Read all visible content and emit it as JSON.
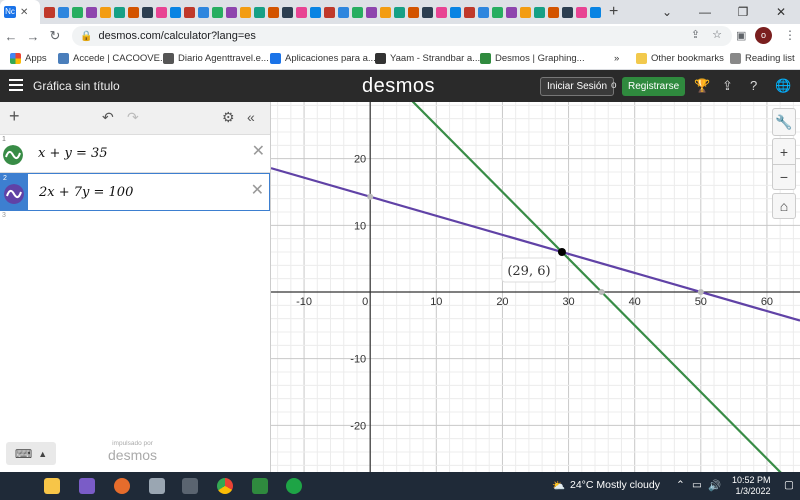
{
  "browser": {
    "active_tab_label": "Nc",
    "url": "desmos.com/calculator?lang=es",
    "bookmarks": [
      {
        "label": "Apps",
        "color": "#ea4335"
      },
      {
        "label": "Accede | CACOOVE...",
        "color": "#4a7ebb"
      },
      {
        "label": "Diario Agenttravel.e...",
        "color": "#555555"
      },
      {
        "label": "Aplicaciones para a...",
        "color": "#1a73e8"
      },
      {
        "label": "Yaam - Strandbar a...",
        "color": "#333333"
      },
      {
        "label": "Desmos | Graphing...",
        "color": "#2f8a3e"
      }
    ],
    "bookmarks_more": "»",
    "other_bookmarks": "Other bookmarks",
    "reading_list": "Reading list",
    "profile_initial": "o"
  },
  "app": {
    "graph_title": "Gráfica sin título",
    "logo": "desmos",
    "login_label": "Iniciar Sesión",
    "or_label": "o",
    "signup_label": "Registrarse"
  },
  "expressions": [
    {
      "index": "1",
      "latex": "x + y = 35",
      "color": "#388c46"
    },
    {
      "index": "2",
      "latex": "2x + 7y = 100",
      "color": "#6042a6"
    },
    {
      "index": "3",
      "latex": ""
    }
  ],
  "powered_by": {
    "small": "impulsado por",
    "brand": "desmos"
  },
  "chart_data": {
    "type": "line",
    "x_range": [
      -15,
      65
    ],
    "y_range": [
      -27,
      28.5
    ],
    "x_ticks": [
      -10,
      0,
      10,
      20,
      30,
      40,
      50,
      60
    ],
    "y_ticks": [
      -20,
      -10,
      10,
      20
    ],
    "grid": true,
    "series": [
      {
        "equation": "x + y = 35",
        "color": "#388c46",
        "intercepts": [
          [
            0,
            35
          ],
          [
            35,
            0
          ]
        ]
      },
      {
        "equation": "2x + 7y = 100",
        "color": "#6042a6",
        "intercepts": [
          [
            0,
            14.29
          ],
          [
            50,
            0
          ]
        ]
      }
    ],
    "intersection": {
      "x": 29,
      "y": 6,
      "label": "(29, 6)"
    }
  },
  "taskbar": {
    "weather": "24°C  Mostly cloudy",
    "time": "10:52 PM",
    "date": "1/3/2022"
  }
}
